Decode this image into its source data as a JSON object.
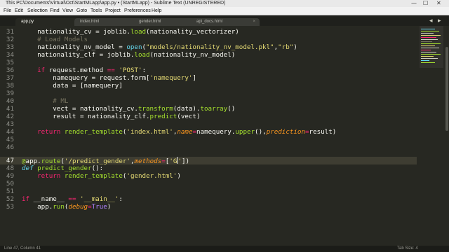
{
  "window": {
    "title": "This PC\\Documents\\Virtual\\Oct\\StartMLapp\\app.py • (StartMLapp) - Sublime Text (UNREGISTERED)",
    "minimize": "—",
    "maximize": "☐",
    "close": "✕"
  },
  "menu": [
    "File",
    "Edit",
    "Selection",
    "Find",
    "View",
    "Goto",
    "Tools",
    "Project",
    "Preferences",
    "Help"
  ],
  "tabs": [
    {
      "label": "app.py",
      "active": true
    },
    {
      "label": "index.html",
      "active": false
    },
    {
      "label": "gender.html",
      "active": false
    },
    {
      "label": "api_docs.html",
      "active": false
    }
  ],
  "tab_scroll": {
    "left": "◂",
    "right": "▸"
  },
  "editor": {
    "line_numbers": [
      "31",
      "32",
      "33",
      "34",
      "35",
      "36",
      "37",
      "38",
      "39",
      "40",
      "41",
      "42",
      "43",
      "44",
      "45",
      "46",
      "47",
      "48",
      "49",
      "50",
      "51",
      "52",
      "53"
    ],
    "current_line": "47",
    "current_line_index": 16
  },
  "status": {
    "left": "Line 47, Column 41",
    "right": "Tab Size: 4"
  },
  "colors": {
    "background": "#272822",
    "string": "#e6db74",
    "keyword": "#f92672",
    "builtin": "#66d9ef",
    "comment": "#75715e",
    "function": "#a6e22e",
    "parameter": "#fd971f",
    "constant": "#ae81ff"
  },
  "icons": [
    "minimize-icon",
    "maximize-icon",
    "close-icon",
    "tab-close-icon",
    "chevron-left-icon",
    "chevron-right-icon"
  ]
}
